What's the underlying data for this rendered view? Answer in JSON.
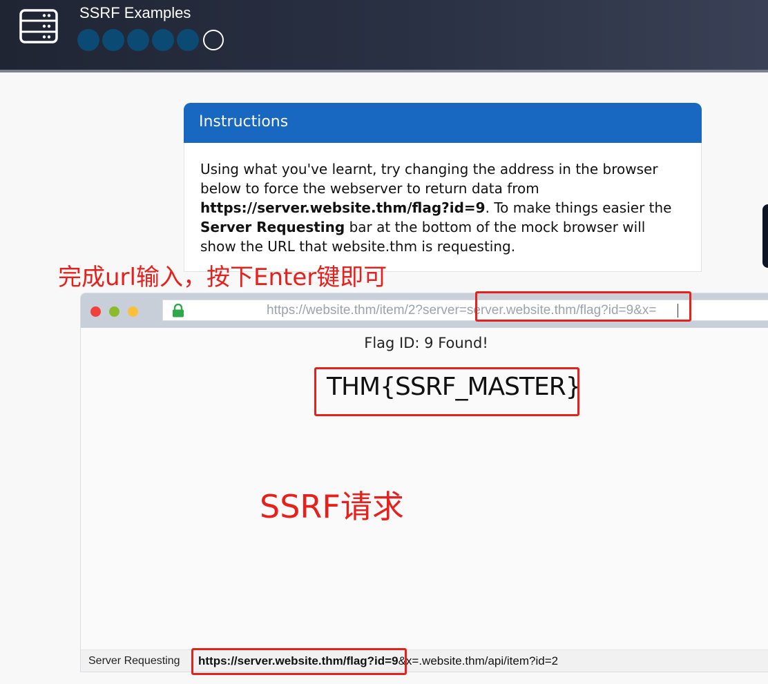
{
  "header": {
    "title": "SSRF Examples",
    "icon": "server-icon",
    "progress": {
      "completed": 5,
      "total": 6
    }
  },
  "instructions": {
    "heading": "Instructions",
    "text_1": "Using what you've learnt, try changing the address in the browser below to force the webserver to return data from ",
    "flag_url": "https://server.website.thm/flag?id=9",
    "text_2": ". To make things easier the ",
    "bar_name": "Server Requesting",
    "text_3": " bar at the bottom of the mock browser will show the URL that website.thm is requesting."
  },
  "annotations": {
    "enter_hint": "完成url输入，按下Enter键即可",
    "ssrf_label": "SSRF请求"
  },
  "browser": {
    "url_value": "https://website.thm/item/2?server=server.website.thm/flag?id=9&x=",
    "flag_found": "Flag ID: 9 Found!",
    "flag_value": "THM{SSRF_MASTER}",
    "status_label": "Server Requesting",
    "status_url_strong": "https://server.website.thm/flag?id=9",
    "status_url_rest": "&x=.website.thm/api/item?id=2"
  },
  "colors": {
    "header_bg": "#2a3144",
    "card_header": "#1867c0",
    "progress_dot": "#0a4a73",
    "annotation": "#e8201c"
  }
}
